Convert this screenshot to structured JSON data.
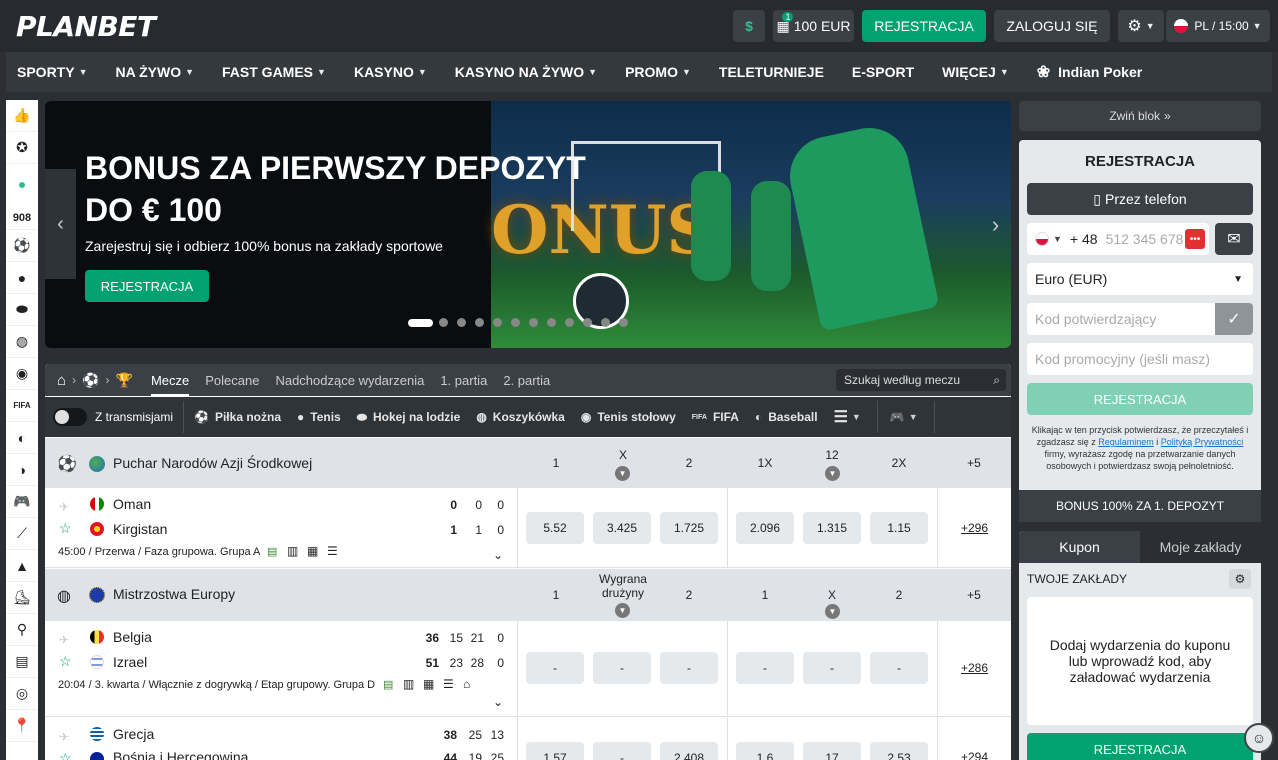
{
  "header": {
    "logo": "PLANBET",
    "bonus_badge": "1",
    "bonus_amount": "100 EUR",
    "register_label": "REJESTRACJA",
    "login_label": "ZALOGUJ SIĘ",
    "lang_time": "PL / 15:00"
  },
  "nav": {
    "items": [
      "SPORTY",
      "NA ŻYWO",
      "FAST GAMES",
      "KASYNO",
      "KASYNO NA ŻYWO",
      "PROMO",
      "TELETURNIEJE",
      "E-SPORT",
      "WIĘCEJ"
    ],
    "indian_poker": "Indian Poker"
  },
  "sidebar": {
    "live_count": "908"
  },
  "banner": {
    "title_line1": "BONUS ZA PIERWSZY DEPOZYT",
    "title_line2": "DO € 100",
    "subtitle": "Zarejestruj się i odbierz 100% bonus na zakłady sportowe",
    "button": "REJESTRACJA",
    "art_text": "ONUS"
  },
  "tabs": {
    "items": [
      "Mecze",
      "Polecane",
      "Nadchodzące wydarzenia",
      "1. partia",
      "2. partia"
    ],
    "active": "Mecze",
    "search_placeholder": "Szukaj według meczu"
  },
  "sports_filter": {
    "toggle_label": "Z transmisjami",
    "items": [
      "Piłka nożna",
      "Tenis",
      "Hokej na lodzie",
      "Koszykówka",
      "Tenis stołowy",
      "FIFA",
      "Baseball"
    ]
  },
  "groups": [
    {
      "name": "Puchar Narodów Azji Środkowej",
      "cols": [
        "1",
        "X",
        "2",
        "1X",
        "12",
        "2X"
      ],
      "more": "+5",
      "match": {
        "team1": "Oman",
        "team2": "Kirgistan",
        "s1": [
          "0",
          "0",
          "0"
        ],
        "s2": [
          "1",
          "1",
          "0"
        ],
        "info": "45:00 / Przerwa / Faza grupowa. Grupa A",
        "odds": [
          "5.52",
          "3.425",
          "1.725",
          "2.096",
          "1.315",
          "1.15"
        ],
        "markets": "+296"
      }
    },
    {
      "name": "Mistrzostwa Europy",
      "cols": [
        "1",
        "Wygrana drużyny",
        "2",
        "1",
        "X",
        "2"
      ],
      "more": "+5",
      "match": {
        "team1": "Belgia",
        "team2": "Izrael",
        "s1": [
          "36",
          "15",
          "21",
          "0"
        ],
        "s2": [
          "51",
          "23",
          "28",
          "0"
        ],
        "info": "20:04 / 3. kwarta / Włącznie z dogrywką / Etap grupowy. Grupa D",
        "odds": [
          "-",
          "-",
          "-",
          "-",
          "-",
          "-"
        ],
        "markets": "+286"
      },
      "match2": {
        "team1": "Grecja",
        "team2": "Bośnia i Hercegowina",
        "s1": [
          "38",
          "25",
          "13"
        ],
        "s2": [
          "44",
          "19",
          "25"
        ],
        "odds": [
          "1.57",
          "-",
          "2.408",
          "1.6",
          "17",
          "2.53"
        ],
        "markets": "+294"
      }
    }
  ],
  "right_panel": {
    "collapse": "Zwiń blok",
    "reg_title": "REJESTRACJA",
    "by_phone": "Przez telefon",
    "phone_code": "+ 48",
    "phone_placeholder": "512 345 678",
    "currency": "Euro (EUR)",
    "confirm_code_ph": "Kod potwierdzający",
    "promo_ph": "Kod promocyjny (jeśli masz)",
    "reg_button": "REJESTRACJA",
    "terms_prefix": "Klikając w ten przycisk potwierdzasz, że przeczytałeś i zgadzasz się z",
    "terms_link": "Regulaminem",
    "terms_and": "i",
    "privacy_link": "Polityką Prywatności",
    "terms_suffix": "firmy, wyrażasz zgodę na przetwarzanie danych osobowych i potwierdzasz swoją pełnoletniość.",
    "bonus_banner": "BONUS 100% ZA 1. DEPOZYT",
    "coupon_tab": "Kupon",
    "my_bets_tab": "Moje zakłady",
    "your_bets": "TWOJE ZAKŁADY",
    "empty_msg": "Dodaj wydarzenia do kuponu lub wprowadź kod, aby załadować wydarzenia",
    "bottom_reg": "REJESTRACJA"
  },
  "colors": {
    "accent": "#00a26e",
    "bg": "#2b2f33"
  }
}
